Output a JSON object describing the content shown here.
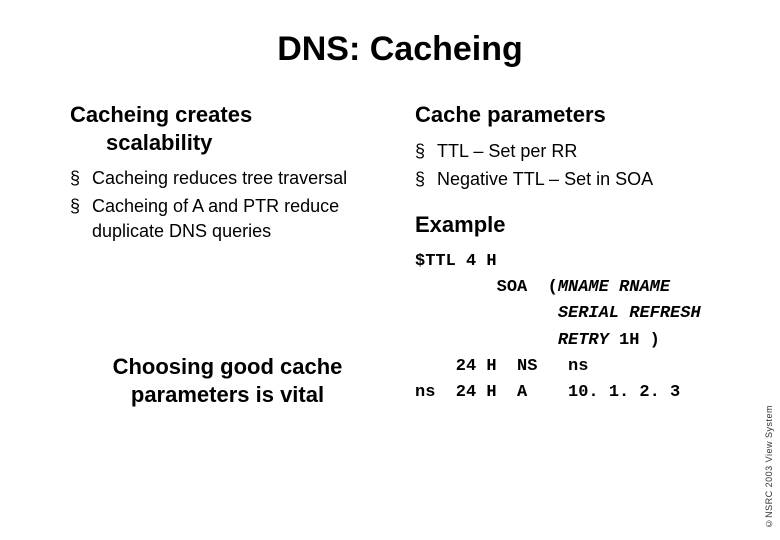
{
  "title": "DNS: Cacheing",
  "left": {
    "heading_line1": "Cacheing creates",
    "heading_line2": "scalability",
    "bullets": {
      "0": "Cacheing reduces tree traversal",
      "1": "Cacheing of A and PTR reduce duplicate DNS queries"
    },
    "vital_line1": "Choosing good cache",
    "vital_line2": "parameters is vital"
  },
  "right": {
    "heading1": "Cache parameters",
    "bullets": {
      "0": "TTL  – Set per RR",
      "1": "Negative TTL           – Set in SOA"
    },
    "heading2": "Example",
    "code": {
      "l1a": "$TTL 4 H",
      "l2a": "        SOA  (",
      "l2b": "MNAME RNAME",
      "l3a": "              ",
      "l3b": "SERIAL REFRESH",
      "l4a": "              ",
      "l4b": "RETRY ",
      "l4c": "1H )",
      "l5a": "    24 H  NS   ns",
      "l6a": "ns  24 H  A    10. 1. 2. 3"
    }
  },
  "side": "©NSRC 2003 View System"
}
